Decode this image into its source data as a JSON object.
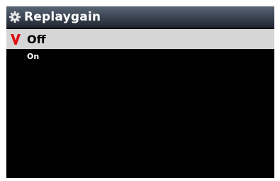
{
  "window": {
    "title": "Replaygain",
    "title_icon": "gear-icon"
  },
  "menu": {
    "items": [
      {
        "label": "Off",
        "selected": true,
        "check_icon": "checkmark-icon"
      },
      {
        "label": "On",
        "selected": false
      }
    ]
  },
  "colors": {
    "check": "#e01010",
    "selected_row_bg": "#d6d6d6",
    "screen_bg": "#000000"
  }
}
